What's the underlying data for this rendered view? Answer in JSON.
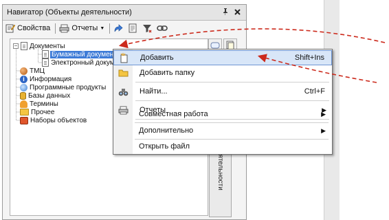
{
  "window": {
    "title": "Навигатор (Объекты деятельности)",
    "pin_glyph": "ᵽ",
    "close_glyph": "✕"
  },
  "toolbar": {
    "properties_label": "Свойства",
    "reports_label": "Отчеты"
  },
  "tree": {
    "items": [
      {
        "label": "Документы"
      },
      {
        "label": "Бумажный документ"
      },
      {
        "label": "Электронный документ"
      },
      {
        "label": "ТМЦ"
      },
      {
        "label": "Информация"
      },
      {
        "label": "Программные продукты"
      },
      {
        "label": "Базы данных"
      },
      {
        "label": "Термины"
      },
      {
        "label": "Прочее"
      },
      {
        "label": "Наборы объектов"
      }
    ]
  },
  "side_tab": {
    "label": "Объекты деятельности"
  },
  "context_menu": {
    "items": [
      {
        "label": "Добавить",
        "shortcut": "Shift+Ins",
        "icon": "new-document-icon",
        "highlighted": true
      },
      {
        "label": "Добавить папку",
        "shortcut": "",
        "icon": "folder-icon"
      },
      {
        "label": "Найти...",
        "shortcut": "Ctrl+F",
        "icon": "binoculars-icon"
      },
      {
        "label": "Отчеты",
        "shortcut": "",
        "icon": "printer-icon",
        "submenu": true
      },
      {
        "label": "Совместная работа",
        "shortcut": "",
        "submenu": true
      },
      {
        "label": "Дополнительно",
        "shortcut": "",
        "submenu": true
      },
      {
        "label": "Открыть файл",
        "shortcut": ""
      }
    ]
  },
  "annotation": {
    "arrow_color": "#cc2a1c"
  }
}
